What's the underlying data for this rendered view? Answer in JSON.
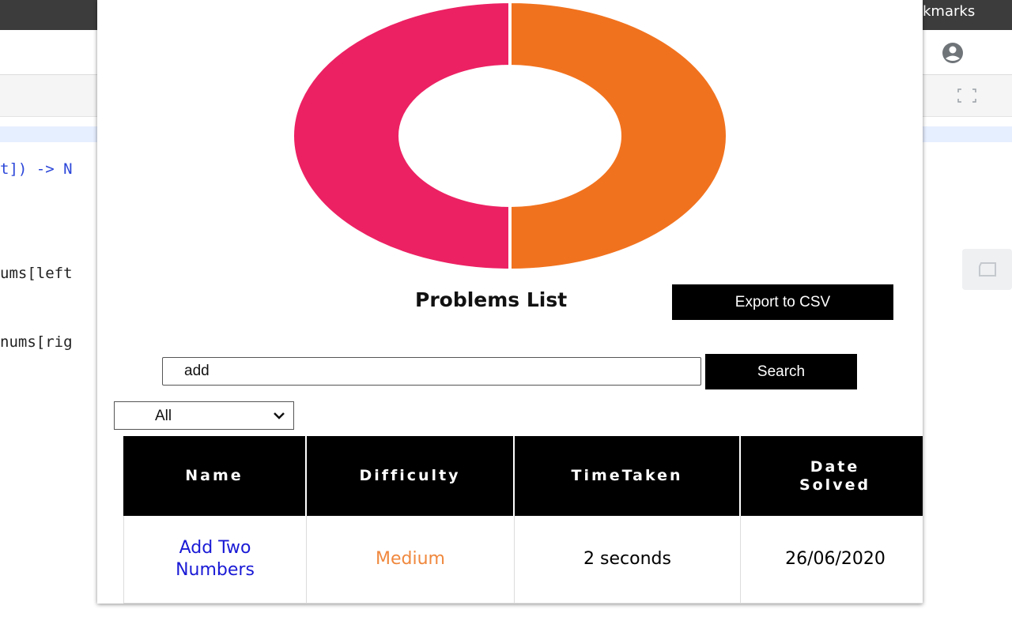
{
  "browser": {
    "bookmarks_label": "kmarks"
  },
  "code": {
    "line1_pre": "t])",
    "line1_arrow": " -> N",
    "line2": "ums[left",
    "line3": "nums[rig"
  },
  "colors": {
    "donut_pink": "#ec2163",
    "donut_orange": "#f1721e",
    "medium": "#f0883e",
    "link": "#1a1ad6"
  },
  "chart_data": {
    "type": "pie",
    "categories": [
      "",
      ""
    ],
    "values": [
      50,
      50
    ],
    "colors": [
      "#ec2163",
      "#f1721e"
    ],
    "title": ""
  },
  "popup": {
    "title": "Problems List",
    "export_label": "Export to CSV",
    "search_value": "add",
    "search_label": "Search",
    "filter_selected": "All",
    "table": {
      "headers": [
        "Name",
        "Difficulty",
        "TimeTaken",
        "Date\nSolved"
      ],
      "rows": [
        {
          "name": "Add Two\nNumbers",
          "difficulty": "Medium",
          "time_taken": "2 seconds",
          "date_solved": "26/06/2020"
        }
      ]
    }
  },
  "icons": {
    "account": "account-circle-icon",
    "fullscreen": "fullscreen-icon",
    "sidebar": "panel-icon",
    "chevron": "chevron-down-icon"
  }
}
